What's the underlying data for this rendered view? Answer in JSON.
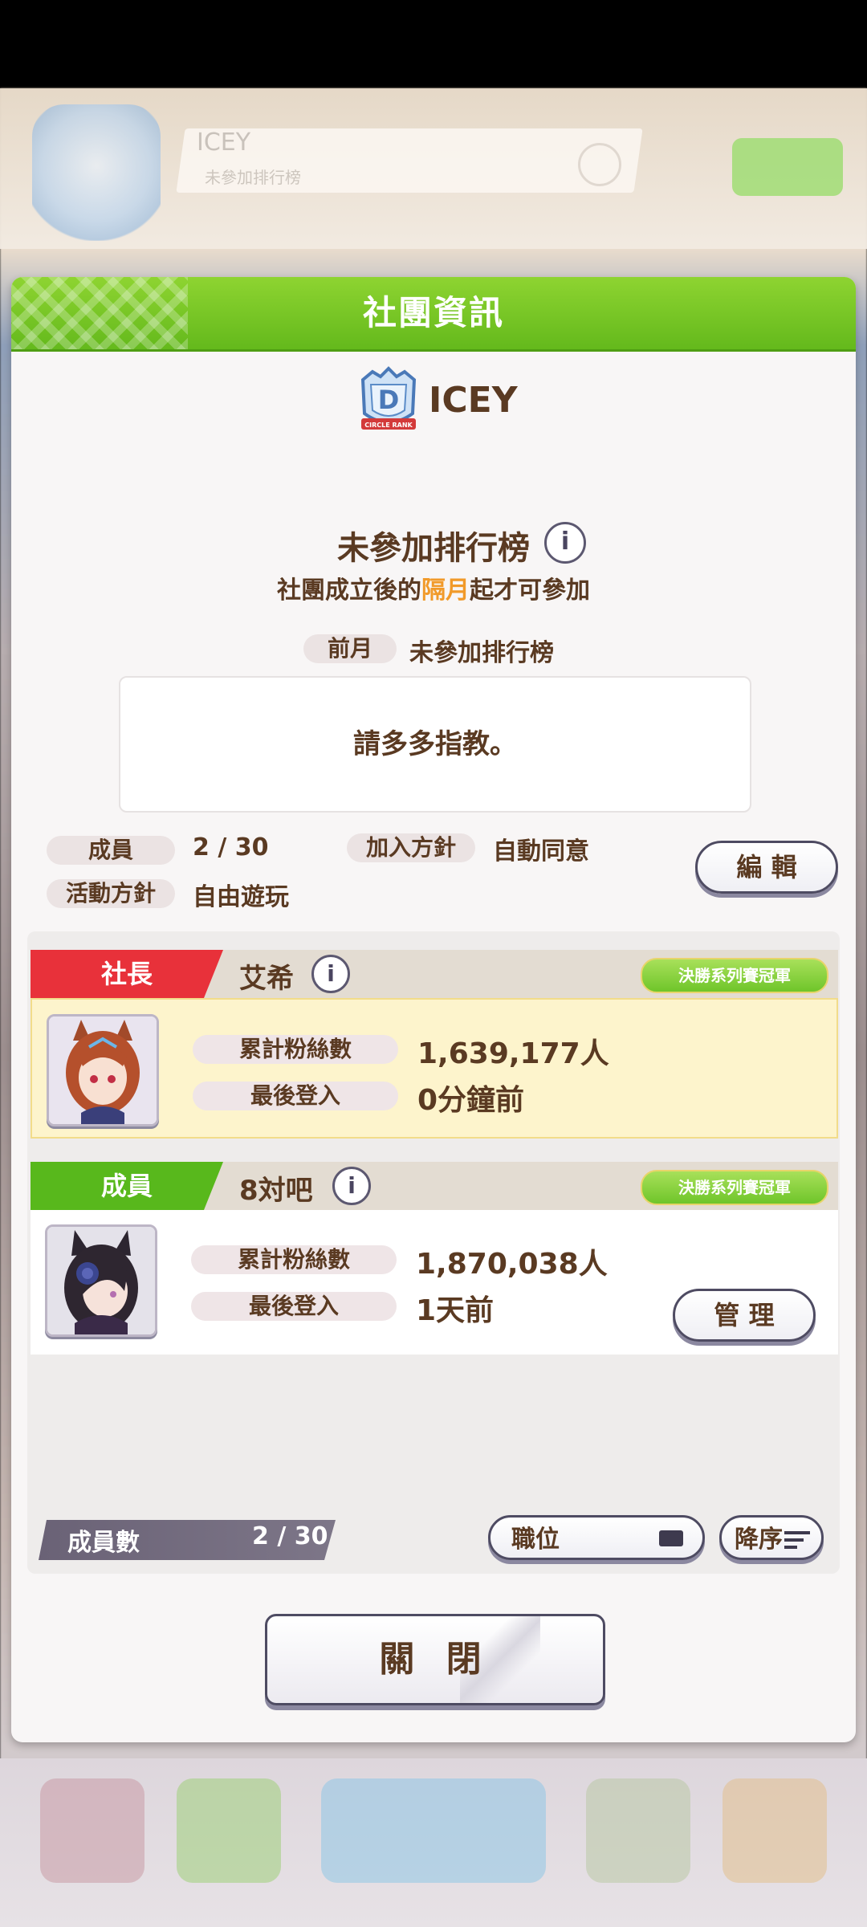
{
  "background": {
    "circle_name": "ICEY",
    "circle_status": "未參加排行榜"
  },
  "panel": {
    "title": "社團資訊",
    "circle_name": "ICEY",
    "emblem_letter": "D",
    "emblem_banner": "CIRCLE RANK"
  },
  "ranking": {
    "title": "未參加排行榜",
    "info_icon": "i",
    "note_prefix": "社團成立後的",
    "note_highlight": "隔月",
    "note_suffix": "起才可參加",
    "last_month_label": "前月",
    "last_month_value": "未參加排行榜"
  },
  "intro": {
    "text": "請多多指教。"
  },
  "circle_info": {
    "members_label": "成員",
    "members_value": "2 / 30",
    "join_policy_label": "加入方針",
    "join_policy_value": "自動同意",
    "activity_label": "活動方針",
    "activity_value": "自由遊玩",
    "edit_button": "編 輯"
  },
  "members": [
    {
      "role": "社長",
      "name": "艾希",
      "badge": "決勝系列賽冠軍",
      "fans_label": "累計粉絲數",
      "fans_value": "1,639,177人",
      "login_label": "最後登入",
      "login_value": "0分鐘前",
      "role_color": "#e8313a",
      "body_color": "#fdf4cc"
    },
    {
      "role": "成員",
      "name": "8対吧",
      "badge": "決勝系列賽冠軍",
      "fans_label": "累計粉絲數",
      "fans_value": "1,870,038人",
      "login_label": "最後登入",
      "login_value": "1天前",
      "manage_button": "管 理",
      "role_color": "#58b81c",
      "body_color": "#ffffff"
    }
  ],
  "footer": {
    "count_label": "成員數",
    "count_value": "2 / 30",
    "sort_by": "職位",
    "order": "降序",
    "close_button": "關 閉"
  },
  "colors": {
    "header_green": "#7cc828",
    "text_brown": "#5a3a22",
    "highlight_orange": "#f19a2a"
  }
}
